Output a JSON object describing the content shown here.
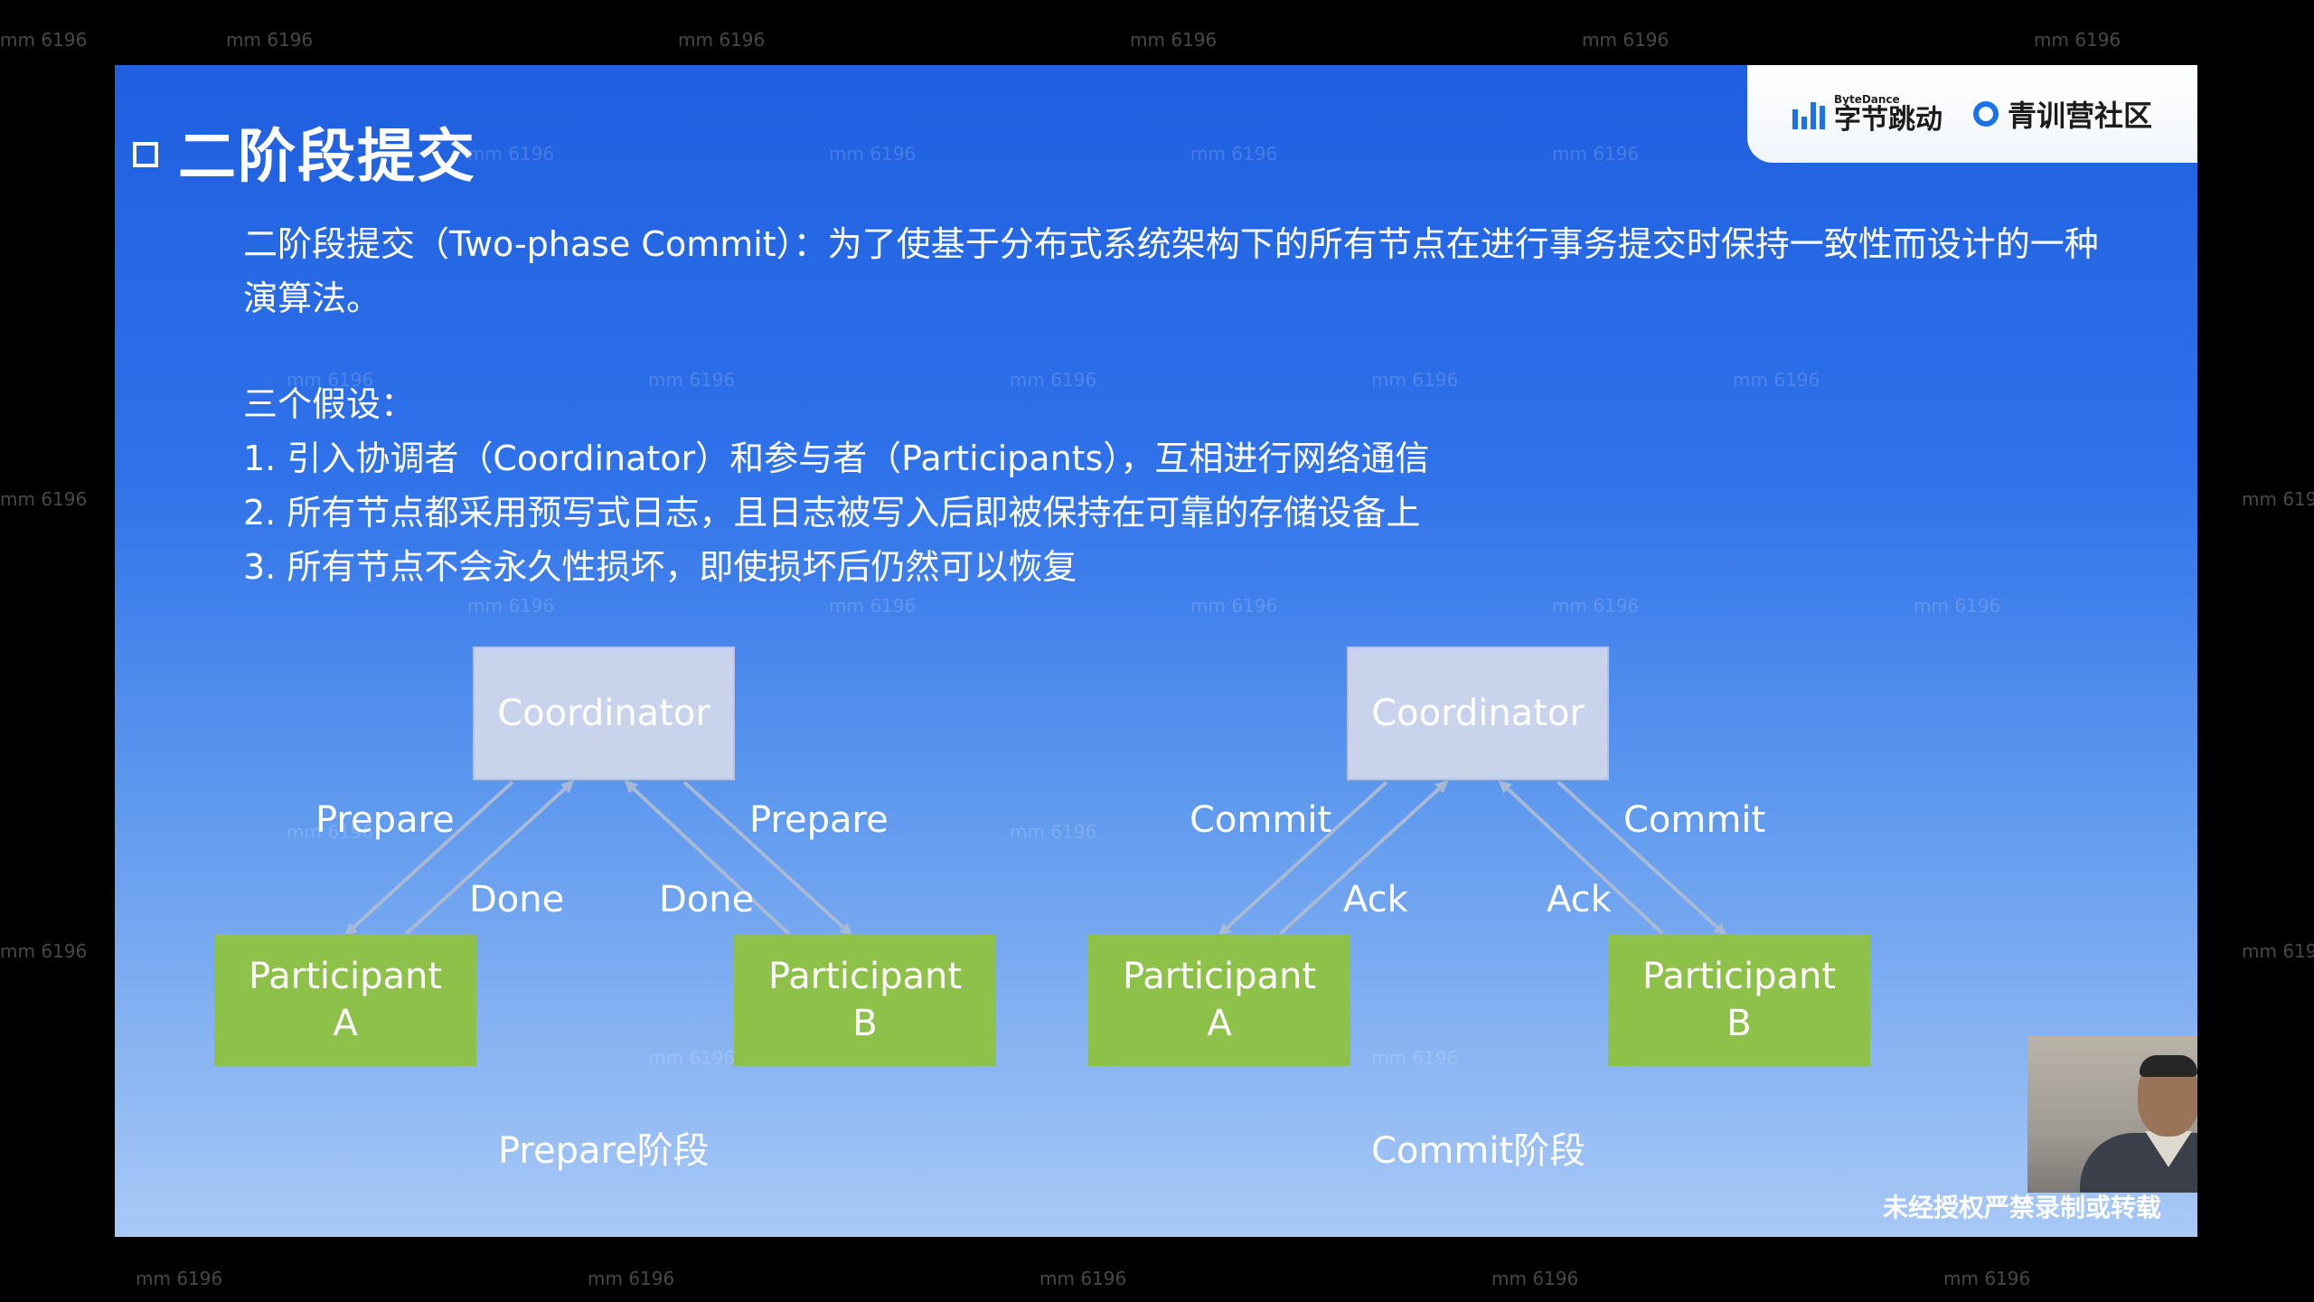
{
  "slide": {
    "title": "二阶段提交",
    "logo_bytedance_small": "ByteDance",
    "logo_bytedance": "字节跳动",
    "logo_community": "青训营社区",
    "description": "二阶段提交（Two-phase Commit）：为了使基于分布式系统架构下的所有节点在进行事务提交时保持一致性而设计的一种演算法。",
    "assumptions_title": "三个假设：",
    "assumptions": [
      "1. 引入协调者（Coordinator）和参与者（Participants），互相进行网络通信",
      "2. 所有节点都采用预写式日志，且日志被写入后即被保持在可靠的存储设备上",
      "3. 所有节点不会永久性损坏，即使损坏后仍然可以恢复"
    ],
    "diagram_prepare": {
      "coordinator": "Coordinator",
      "participant_a_line1": "Participant",
      "participant_a_line2": "A",
      "participant_b_line1": "Participant",
      "participant_b_line2": "B",
      "label_left_down": "Prepare",
      "label_right_down": "Prepare",
      "label_left_up": "Done",
      "label_right_up": "Done",
      "phase": "Prepare阶段"
    },
    "diagram_commit": {
      "coordinator": "Coordinator",
      "participant_a_line1": "Participant",
      "participant_a_line2": "A",
      "participant_b_line1": "Participant",
      "participant_b_line2": "B",
      "label_left_down": "Commit",
      "label_right_down": "Commit",
      "label_left_up": "Ack",
      "label_right_up": "Ack",
      "phase": "Commit阶段"
    },
    "notice": "未经授权严禁录制或转载"
  },
  "watermark": "mm 6196",
  "colors": {
    "slide_top": "#1f5fe0",
    "slide_bottom": "#a9c9f6",
    "coordinator": "#c9d3ec",
    "participant": "#8dc14a",
    "arrow": "#a8b9d6",
    "brand_blue": "#1a73e8"
  }
}
